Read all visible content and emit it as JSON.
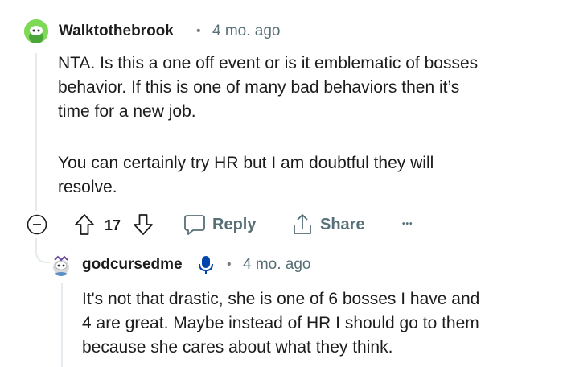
{
  "comment": {
    "username": "Walktothebrook",
    "separator": "•",
    "time": "4 mo. ago",
    "body_p1_l1": "NTA. Is this a one off event or is it emblematic of bosses",
    "body_p1_l2": "behavior. If this is one of many bad behaviors then it’s",
    "body_p1_l3": "time for a new job.",
    "body_p2_l1": "You can certainly try HR but I am doubtful they will",
    "body_p2_l2": "resolve.",
    "actions": {
      "vote_count": "17",
      "reply_label": "Reply",
      "share_label": "Share",
      "more_label": "•••"
    }
  },
  "reply": {
    "username": "godcursedme",
    "separator": "•",
    "time": "4 mo. ago",
    "body_l1": "It's not that drastic, she is one of 6 bosses I have and",
    "body_l2": "4 are great. Maybe instead of HR I should go to them",
    "body_l3": "because she cares about what they think."
  },
  "colors": {
    "avatar1": "#7ed957",
    "muted": "#576f76",
    "thread_line": "#e5ebee",
    "verified_badge": "#0045ac"
  },
  "icons": {
    "collapse": "collapse-minus-icon",
    "upvote": "upvote-arrow-icon",
    "downvote": "downvote-arrow-icon",
    "reply": "speech-bubble-icon",
    "share": "share-icon",
    "badge": "microphone-badge-icon"
  }
}
